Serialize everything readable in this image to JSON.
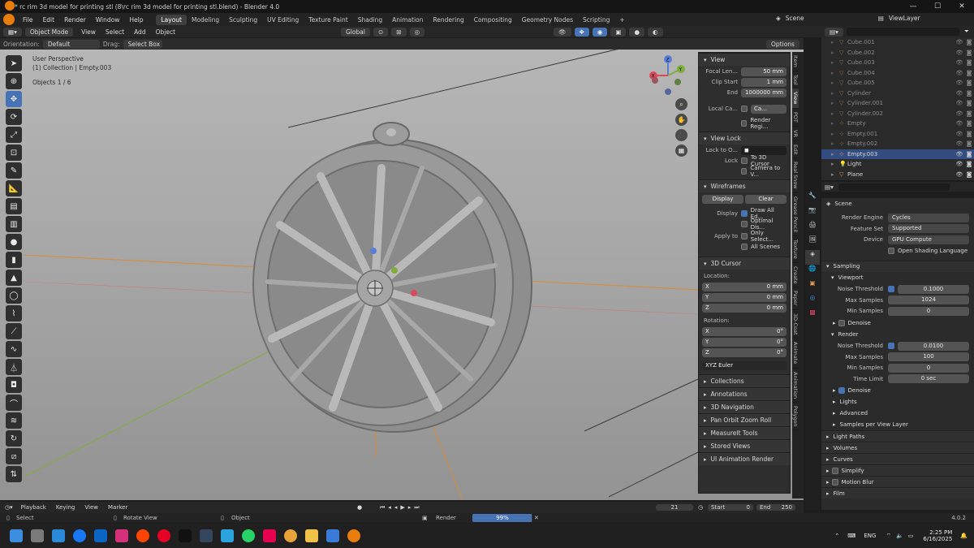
{
  "window": {
    "title": "* rc rim 3d model for printing stl (8\\rc rim 3d model for printing stl.blend) - Blender 4.0"
  },
  "menubar": {
    "menus": [
      "File",
      "Edit",
      "Render",
      "Window",
      "Help"
    ],
    "workspaces": [
      "Layout",
      "Modeling",
      "Sculpting",
      "UV Editing",
      "Texture Paint",
      "Shading",
      "Animation",
      "Rendering",
      "Compositing",
      "Geometry Nodes",
      "Scripting"
    ],
    "scene": "Scene",
    "view_layer": "ViewLayer"
  },
  "viewport_header": {
    "mode": "Object Mode",
    "menus": [
      "View",
      "Select",
      "Add",
      "Object"
    ],
    "transform_orientation": "Global"
  },
  "tool_header": {
    "orientation_label": "Orientation:",
    "orientation_value": "Default",
    "drag_label": "Drag:",
    "drag_value": "Select Box",
    "options": "Options"
  },
  "viewport": {
    "perspective": "User Perspective",
    "collection": "(1) Collection | Empty.003",
    "objects": "Objects    1 / 6",
    "gizmo_axes": {
      "z": "Z",
      "y": "Y",
      "x": "X"
    }
  },
  "npanel": {
    "view_header": "View",
    "focal_length_label": "Focal Len...",
    "focal_length": "50 mm",
    "clip_start_label": "Clip Start",
    "clip_start": "1 mm",
    "clip_end_label": "End",
    "clip_end": "1000000 mm",
    "local_camera_label": "Local Ca...",
    "local_camera_value": "Ca...",
    "render_region": "Render Regi...",
    "view_lock_header": "View Lock",
    "lock_to_label": "Lock to O...",
    "lock_label": "Lock",
    "to_3d_cursor": "To 3D Cursor",
    "camera_to_view": "Camera to V...",
    "wireframes_header": "Wireframes",
    "display_btn": "Display",
    "clear_btn": "Clear",
    "display_label": "Display",
    "draw_all_edges": "Draw All Ed...",
    "optimal_display": "Optimal Dis...",
    "apply_to_label": "Apply to",
    "only_selected": "Only Select...",
    "all_scenes": "All Scenes",
    "cursor_header": "3D Cursor",
    "location_label": "Location:",
    "loc": [
      {
        "axis": "X",
        "val": "0 mm"
      },
      {
        "axis": "Y",
        "val": "0 mm"
      },
      {
        "axis": "Z",
        "val": "0 mm"
      }
    ],
    "rotation_label": "Rotation:",
    "rot": [
      {
        "axis": "X",
        "val": "0°"
      },
      {
        "axis": "Y",
        "val": "0°"
      },
      {
        "axis": "Z",
        "val": "0°"
      }
    ],
    "rotation_mode": "XYZ Euler",
    "collapsed": [
      "Collections",
      "Annotations",
      "3D Navigation",
      "Pan Orbit Zoom Roll",
      "MeasureIt Tools",
      "Stored Views",
      "UI Animation Render"
    ]
  },
  "ntabs": [
    "Item",
    "Tool",
    "View",
    "PDT",
    "VR",
    "Edit",
    "Real Snow",
    "Grease Pencil",
    "Texture",
    "Create",
    "Paper",
    "3D-Coat",
    "Animate",
    "Animation",
    "Polygon"
  ],
  "outliner": {
    "items": [
      {
        "name": "Cube.001",
        "icon": "triangle-icon",
        "dim": true
      },
      {
        "name": "Cube.002",
        "icon": "triangle-icon",
        "dim": true
      },
      {
        "name": "Cube.003",
        "icon": "triangle-icon",
        "dim": true
      },
      {
        "name": "Cube.004",
        "icon": "triangle-icon",
        "dim": true
      },
      {
        "name": "Cube.005",
        "icon": "triangle-icon",
        "dim": true
      },
      {
        "name": "Cylinder",
        "icon": "triangle-icon",
        "dim": true
      },
      {
        "name": "Cylinder.001",
        "icon": "triangle-icon",
        "dim": true
      },
      {
        "name": "Cylinder.002",
        "icon": "triangle-icon",
        "dim": true
      },
      {
        "name": "Empty",
        "icon": "empty-icon",
        "dim": true
      },
      {
        "name": "Empty.001",
        "icon": "empty-icon",
        "dim": true
      },
      {
        "name": "Empty.002",
        "icon": "empty-icon",
        "dim": true
      },
      {
        "name": "Empty.003",
        "icon": "empty-icon",
        "dim": false,
        "selected": true
      },
      {
        "name": "Light",
        "icon": "light-icon",
        "dim": false
      },
      {
        "name": "Plane",
        "icon": "triangle-icon",
        "dim": false
      }
    ]
  },
  "properties": {
    "context": "Scene",
    "render_engine_label": "Render Engine",
    "render_engine": "Cycles",
    "feature_set_label": "Feature Set",
    "feature_set": "Supported",
    "device_label": "Device",
    "device": "GPU Compute",
    "osl": "Open Shading Language",
    "sampling": "Sampling",
    "viewport_sub": "Viewport",
    "vp_noise_label": "Noise Threshold",
    "vp_noise": "0.1000",
    "vp_max_label": "Max Samples",
    "vp_max": "1024",
    "vp_min_label": "Min Samples",
    "vp_min": "0",
    "denoise": "Denoise",
    "render_sub": "Render",
    "r_noise_label": "Noise Threshold",
    "r_noise": "0.0100",
    "r_max_label": "Max Samples",
    "r_max": "100",
    "r_min_label": "Min Samples",
    "r_min": "0",
    "r_time_label": "Time Limit",
    "r_time": "0 sec",
    "denoise2": "Denoise",
    "lights": "Lights",
    "advanced": "Advanced",
    "spvl": "Samples per View Layer",
    "light_paths": "Light Paths",
    "volumes": "Volumes",
    "curves": "Curves",
    "simplify": "Simplify",
    "motion_blur": "Motion Blur",
    "film": "Film"
  },
  "timeline": {
    "menus": [
      "Playback",
      "Keying",
      "View",
      "Marker"
    ],
    "current_frame": "21",
    "start_label": "Start",
    "start": "0",
    "end_label": "End",
    "end": "250"
  },
  "statusbar": {
    "select": "Select",
    "rotate_view": "Rotate View",
    "object": "Object",
    "render": "Render",
    "progress_text": "99%",
    "progress": 0.99,
    "version": "4.0.2"
  },
  "taskbar": {
    "lang": "ENG",
    "time": "2:25 PM",
    "date": "6/16/2025"
  },
  "colors": {
    "accent": "#4772b3",
    "orange": "#e87d0d",
    "selected_row": "#334d80"
  }
}
